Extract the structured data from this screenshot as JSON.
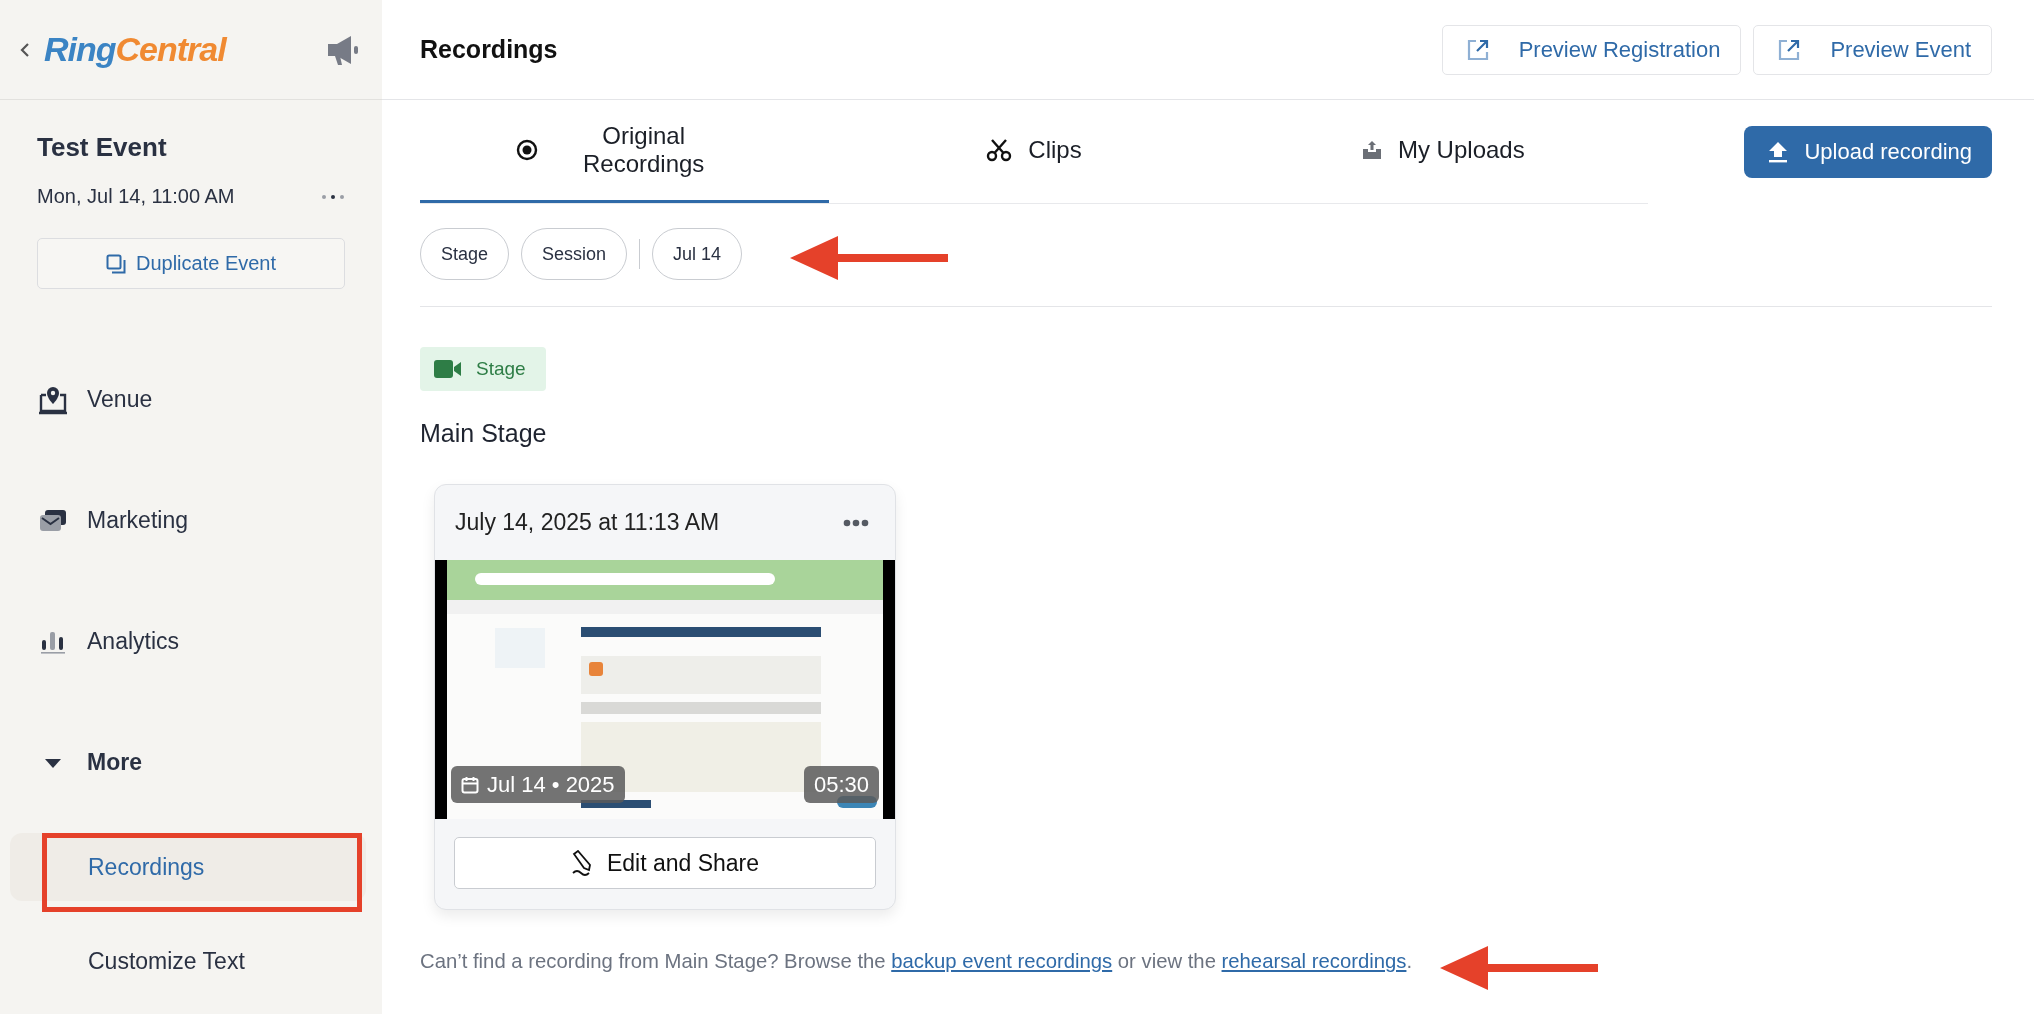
{
  "sidebar": {
    "logo": [
      {
        "text": "Ring",
        "color": "#3b84c4"
      },
      {
        "text": "Central",
        "color": "#f08a32"
      }
    ],
    "event": {
      "title": "Test Event",
      "date": "Mon, Jul 14, 11:00 AM",
      "duplicate_button": "Duplicate Event"
    },
    "nav": [
      {
        "label": "Venue"
      },
      {
        "label": "Marketing"
      },
      {
        "label": "Analytics"
      }
    ],
    "more": {
      "label": "More",
      "expanded": true,
      "children": [
        {
          "label": "Recordings",
          "selected": true
        },
        {
          "label": "Customize Text",
          "selected": false
        }
      ]
    }
  },
  "header": {
    "title": "Recordings",
    "buttons": [
      "Preview Registration",
      "Preview Event"
    ]
  },
  "tabs": [
    {
      "label": "Original Recordings",
      "selected": true
    },
    {
      "label": "Clips",
      "selected": false
    },
    {
      "label": "My Uploads",
      "selected": false
    }
  ],
  "upload_button": "Upload recording",
  "filter_groups": [
    [
      "Stage",
      "Session"
    ],
    [
      "Jul 14"
    ]
  ],
  "section": {
    "badge": "Stage",
    "title": "Main Stage",
    "recordings": [
      {
        "title": "July 14, 2025 at 11:13 AM",
        "date_badge": "Jul 14 • 2025",
        "duration": "05:30",
        "button": "Edit and Share"
      }
    ]
  },
  "footer_note": [
    {
      "kind": "text",
      "text": "Can’t find a recording from Main Stage? Browse the "
    },
    {
      "kind": "link",
      "text": "backup event recordings"
    },
    {
      "kind": "text",
      "text": " or view the "
    },
    {
      "kind": "link",
      "text": "rehearsal recordings"
    },
    {
      "kind": "text",
      "text": "."
    }
  ]
}
